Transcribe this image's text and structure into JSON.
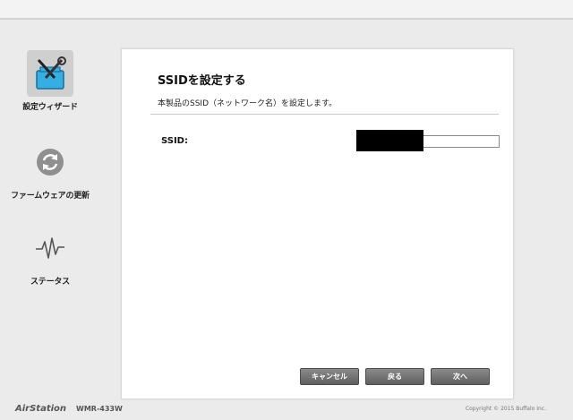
{
  "sidebar": {
    "items": [
      {
        "label": "設定ウィザード",
        "icon": "wizard-tools-icon",
        "active": true
      },
      {
        "label": "ファームウェアの更新",
        "icon": "refresh-icon",
        "active": false
      },
      {
        "label": "ステータス",
        "icon": "pulse-icon",
        "active": false
      }
    ]
  },
  "panel": {
    "title": "SSIDを設定する",
    "description": "本製品のSSID（ネットワーク名）を設定します。",
    "ssid_label": "SSID:",
    "ssid_value": ""
  },
  "buttons": {
    "cancel": "キャンセル",
    "back": "戻る",
    "next": "次へ"
  },
  "footer": {
    "brand": "AirStation",
    "model": "WMR-433W",
    "copyright": "Copyright © 2015 Buffalo Inc."
  },
  "colors": {
    "background": "#ebebeb",
    "panel": "#ffffff",
    "wizard_icon_blue": "#35aee3",
    "button": "#6f6f6f"
  }
}
